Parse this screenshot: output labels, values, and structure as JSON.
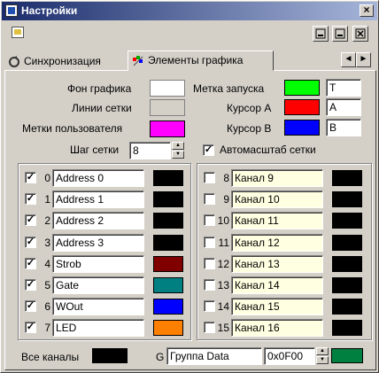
{
  "window": {
    "title": "Настройки"
  },
  "tabs": [
    {
      "label": "Синхронизация"
    },
    {
      "label": "Элементы графика"
    }
  ],
  "tab_scroll": {
    "left": "◄",
    "right": "►"
  },
  "settings": {
    "chart_bg_label": "Фон графика",
    "chart_bg_color": "#ffffff",
    "grid_lines_label": "Линии сетки",
    "grid_lines_color": "#d4d0c8",
    "user_marks_label": "Метки пользователя",
    "user_marks_color": "#ff00ff",
    "grid_step_label": "Шаг сетки",
    "grid_step_value": "8",
    "trigger_label": "Метка запуска",
    "trigger_color": "#00ff00",
    "trigger_text": "T",
    "cursor_a_label": "Курсор А",
    "cursor_a_color": "#ff0000",
    "cursor_a_text": "A",
    "cursor_b_label": "Курсор В",
    "cursor_b_color": "#0000ff",
    "cursor_b_text": "B",
    "autoscale_label": "Автомасштаб сетки",
    "autoscale_checked": true
  },
  "channels_left": [
    {
      "num": "0",
      "name": "Address 0",
      "color": "#000000",
      "checked": true
    },
    {
      "num": "1",
      "name": "Address 1",
      "color": "#000000",
      "checked": true
    },
    {
      "num": "2",
      "name": "Address 2",
      "color": "#000000",
      "checked": true
    },
    {
      "num": "3",
      "name": "Address 3",
      "color": "#000000",
      "checked": true
    },
    {
      "num": "4",
      "name": "Strob",
      "color": "#800000",
      "checked": true
    },
    {
      "num": "5",
      "name": "Gate",
      "color": "#008080",
      "checked": true
    },
    {
      "num": "6",
      "name": "WOut",
      "color": "#0000ff",
      "checked": true
    },
    {
      "num": "7",
      "name": "LED",
      "color": "#ff8000",
      "checked": true
    }
  ],
  "channels_right": [
    {
      "num": "8",
      "name": "Канал 9",
      "color": "#000000",
      "checked": false
    },
    {
      "num": "9",
      "name": "Канал 10",
      "color": "#000000",
      "checked": false
    },
    {
      "num": "10",
      "name": "Канал 11",
      "color": "#000000",
      "checked": false
    },
    {
      "num": "11",
      "name": "Канал 12",
      "color": "#000000",
      "checked": false
    },
    {
      "num": "12",
      "name": "Канал 13",
      "color": "#000000",
      "checked": false
    },
    {
      "num": "13",
      "name": "Канал 14",
      "color": "#000000",
      "checked": false
    },
    {
      "num": "14",
      "name": "Канал 15",
      "color": "#000000",
      "checked": false
    },
    {
      "num": "15",
      "name": "Канал 16",
      "color": "#000000",
      "checked": false
    }
  ],
  "footer": {
    "all_channels_label": "Все каналы",
    "all_channels_color": "#000000",
    "group_letter": "G",
    "group_name": "Группа Data",
    "group_value": "0x0F00",
    "group_color": "#008040"
  }
}
